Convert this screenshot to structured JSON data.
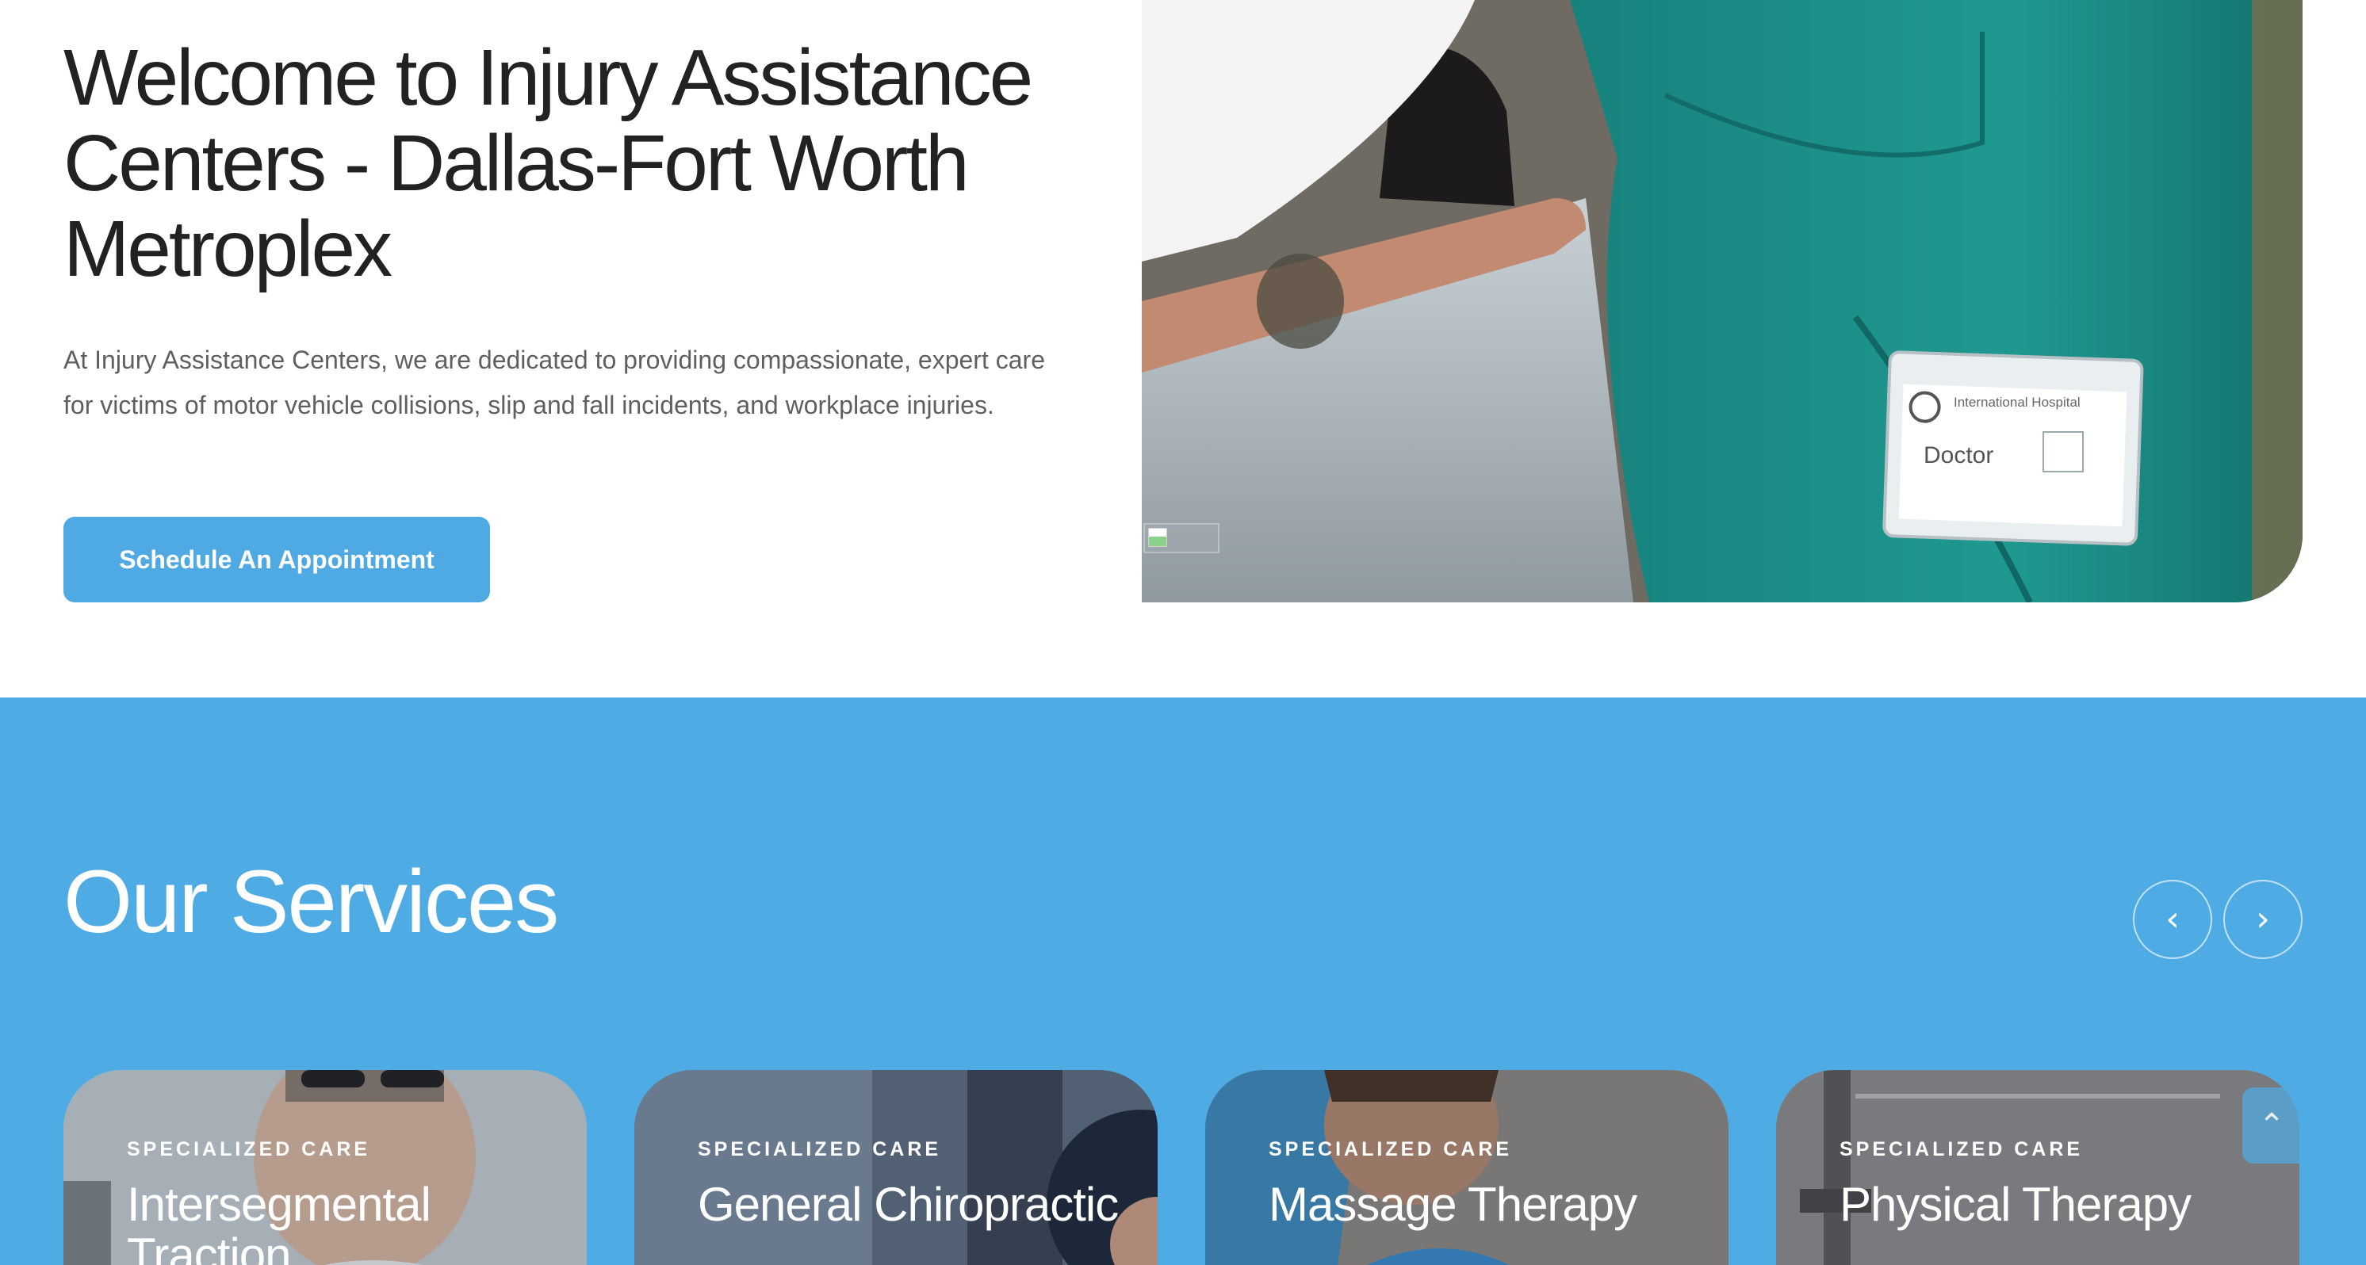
{
  "hero": {
    "title": "Welcome to Injury Assistance Centers - Dallas-Fort Worth Metroplex",
    "description": "At Injury Assistance Centers, we are dedicated to providing compassionate, expert care for victims of motor vehicle collisions, slip and fall incidents, and workplace injuries.",
    "cta_label": "Schedule An Appointment",
    "badge_org": "International Hospital",
    "badge_role": "Doctor"
  },
  "services": {
    "title": "Our Services",
    "prev_icon": "chevron-left-icon",
    "next_icon": "chevron-right-icon",
    "cards": [
      {
        "eyebrow": "SPECIALIZED CARE",
        "title": "Intersegmental Traction"
      },
      {
        "eyebrow": "SPECIALIZED CARE",
        "title": "General Chiropractic"
      },
      {
        "eyebrow": "SPECIALIZED CARE",
        "title": "Massage Therapy"
      },
      {
        "eyebrow": "SPECIALIZED CARE",
        "title": "Physical Therapy"
      }
    ]
  },
  "scroll_top_icon": "chevron-up-icon",
  "colors": {
    "accent": "#4fabe4",
    "button": "#4fa9e3",
    "heading": "#222222",
    "body_text": "#5f5f5f",
    "scrubs": "#1f8f88"
  }
}
